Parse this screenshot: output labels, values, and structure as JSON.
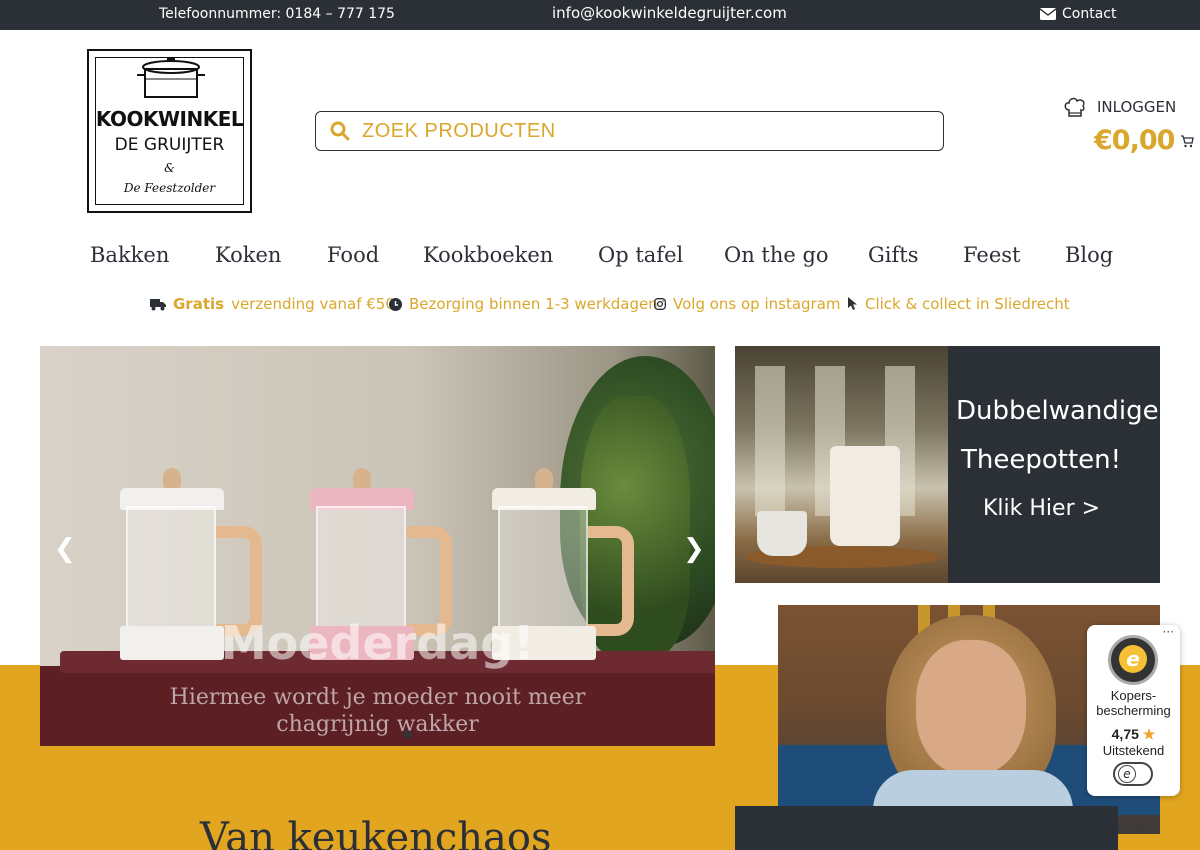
{
  "topbar": {
    "phone": "Telefoonnummer: 0184 – 777 175",
    "email": "info@kookwinkeldegruijter.com",
    "contact": "Contact"
  },
  "logo": {
    "line1": "KOOKWINKEL",
    "line2": "DE GRUIJTER",
    "line3": "&",
    "line4": "De Feestzolder"
  },
  "search": {
    "placeholder": "ZOEK PRODUCTEN",
    "value": ""
  },
  "account": {
    "login_label": "INLOGGEN",
    "cart_total": "€0,00"
  },
  "nav": {
    "items": [
      "Bakken",
      "Koken",
      "Food",
      "Kookboeken",
      "Op tafel",
      "On the go",
      "Gifts",
      "Feest",
      "Blog"
    ]
  },
  "usps": {
    "shipping_bold": "Gratis",
    "shipping_rest": "verzending vanaf €50",
    "delivery": "Bezorging binnen 1-3 werkdagen",
    "instagram": "Volg ons op instagram",
    "collect": "Click & collect in Sliedrecht"
  },
  "slider": {
    "title": "Moederdag!",
    "subtitle": "Hiermee wordt je moeder nooit meer chagrijnig wakker"
  },
  "promo": {
    "line1": "Dubbelwandige",
    "line2": "Theepotten!",
    "cta": "Klik Hier >"
  },
  "band": {
    "headline": "Van keukenchaos"
  },
  "trusted_shops": {
    "more": "···",
    "protection": "Kopers-bescherming",
    "score": "4,75",
    "verdict": "Uitstekend"
  },
  "colors": {
    "accent": "#d9a72b",
    "dark": "#2b2f36",
    "band": "#e2a51f"
  }
}
